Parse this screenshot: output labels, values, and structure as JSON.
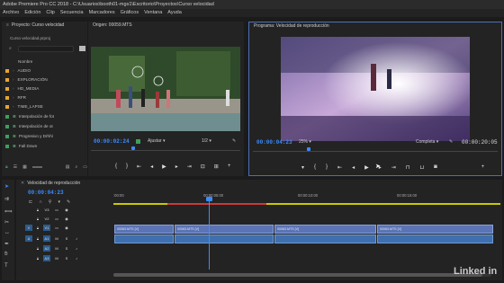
{
  "window": {
    "title": "Adobe Premiere Pro CC 2018 - C:\\Usuarios\\booth01-mgs1\\Escritorio\\Proyectos\\Curso velocidad"
  },
  "menu": [
    "Archivo",
    "Edición",
    "Clip",
    "Secuencia",
    "Marcadores",
    "Gráficos",
    "Ventana",
    "Ayuda"
  ],
  "project": {
    "tab": "Proyecto: Curso velocidad",
    "file": "Curso velocidad.prproj",
    "column": "Nombre",
    "items": [
      {
        "label": "AUDIO",
        "color": "#e8a534",
        "kind": "folder"
      },
      {
        "label": "EXPLORACIÓN",
        "color": "#e8a534",
        "kind": "folder"
      },
      {
        "label": "HD_MEDIA",
        "color": "#e8a534",
        "kind": "folder"
      },
      {
        "label": "RFR",
        "color": "#e8a534",
        "kind": "folder"
      },
      {
        "label": "TIME_LAPSE",
        "color": "#e8a534",
        "kind": "folder"
      },
      {
        "label": "Interpolación de fot",
        "color": "#3ca05a",
        "kind": "sequence"
      },
      {
        "label": "Interpolación de ot",
        "color": "#3ca05a",
        "kind": "sequence"
      },
      {
        "label": "Progresivo y Drhhl",
        "color": "#3ca05a",
        "kind": "sequence"
      },
      {
        "label": "Fall Down",
        "color": "#3ca05a",
        "kind": "sequence"
      }
    ]
  },
  "source": {
    "tab": "Origen: 00059.MTS",
    "timecode": "00:00:02:24",
    "fit": "Ajustar",
    "resolution": "1/2"
  },
  "program": {
    "tab": "Programa: Velocidad de reproducción",
    "timecode": "00:00:04:23",
    "zoom": "25%",
    "quality": "Completa",
    "duration": "00:00:20:05"
  },
  "timeline": {
    "tab": "Velocidad de reproducción",
    "timecode": "00:00:04:23",
    "ruler": [
      ":00:00",
      "00:00:05:00",
      "00:00:10:00",
      "00:00:15:00"
    ],
    "tracks": [
      "V3",
      "V2",
      "V1",
      "A1",
      "A2",
      "A3"
    ],
    "clips": [
      "00063.MTS [V]",
      "00063.MTS [V]",
      "00063.MTS [V]",
      "00063.MTS [V]"
    ]
  },
  "watermark": "Linked in"
}
